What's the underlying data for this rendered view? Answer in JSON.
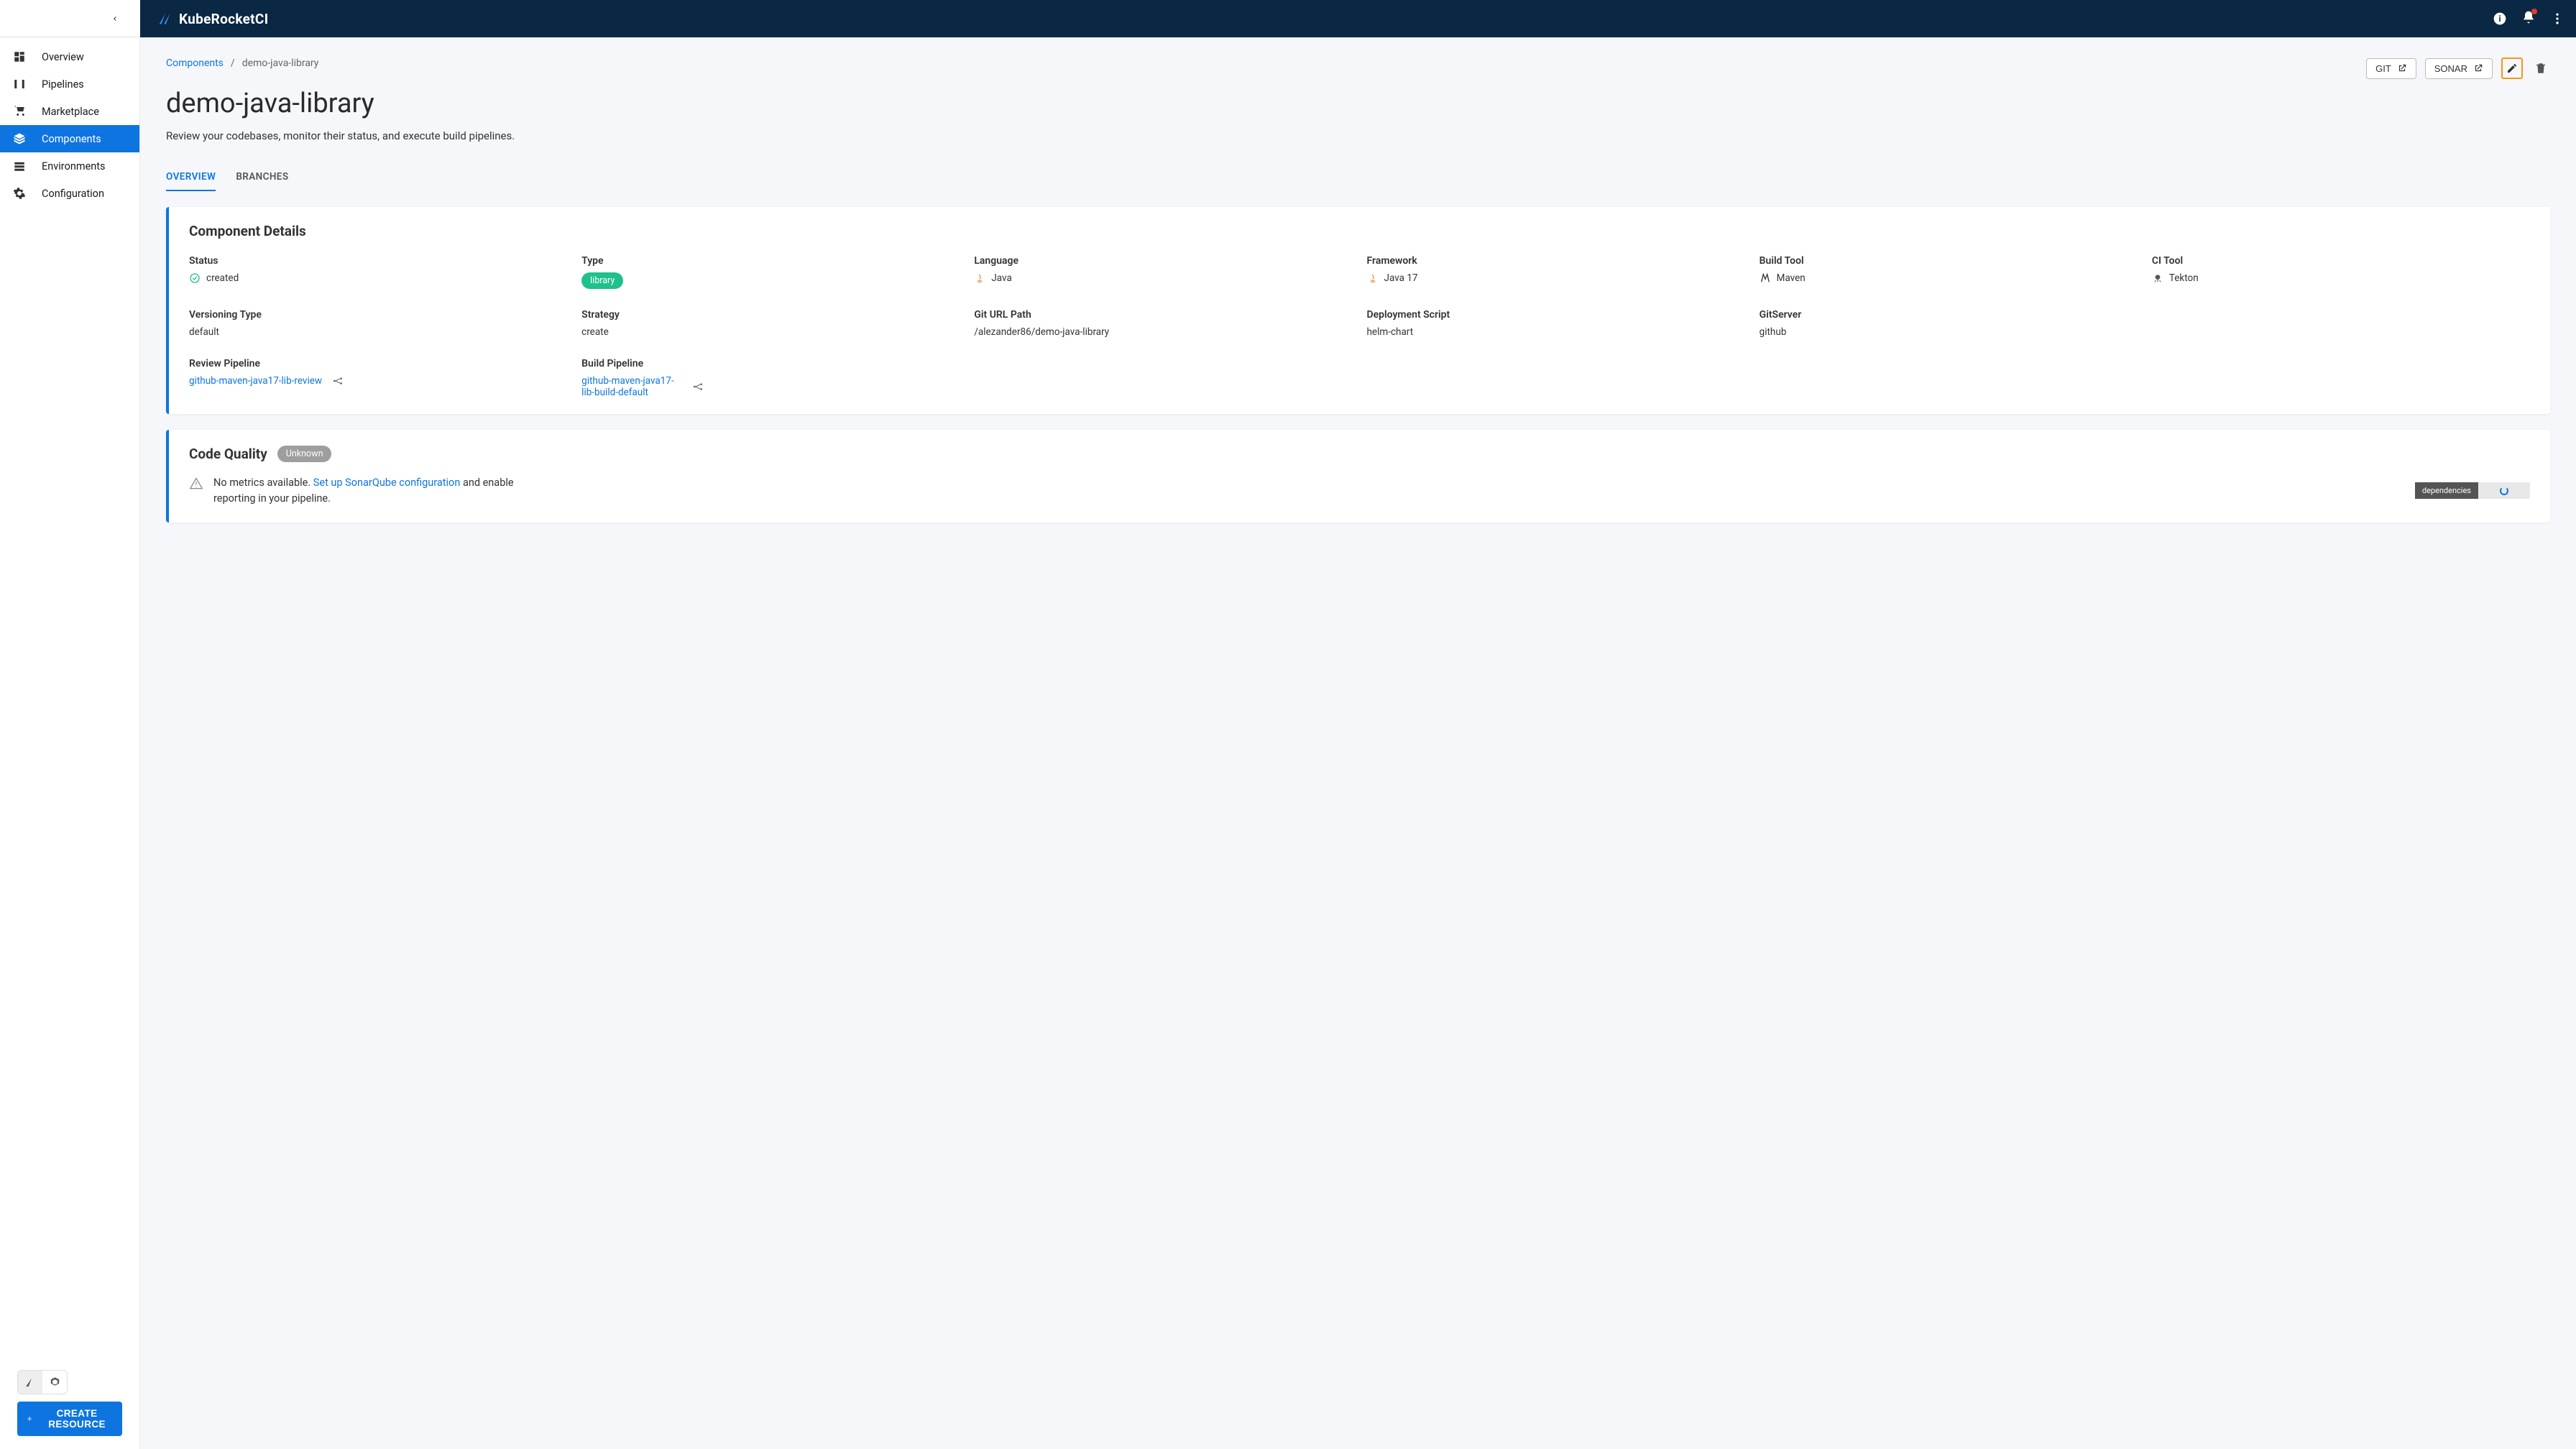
{
  "brand": "KubeRocketCI",
  "sidebar": {
    "items": [
      {
        "label": "Overview"
      },
      {
        "label": "Pipelines"
      },
      {
        "label": "Marketplace"
      },
      {
        "label": "Components"
      },
      {
        "label": "Environments"
      },
      {
        "label": "Configuration"
      }
    ],
    "create_label": "CREATE RESOURCE"
  },
  "breadcrumb": {
    "root": "Components",
    "current": "demo-java-library"
  },
  "actions": {
    "git": "GIT",
    "sonar": "SONAR"
  },
  "page": {
    "title": "demo-java-library",
    "subtitle": "Review your codebases, monitor their status, and execute build pipelines."
  },
  "tabs": {
    "overview": "OVERVIEW",
    "branches": "BRANCHES"
  },
  "component_details": {
    "title": "Component Details",
    "status_label": "Status",
    "status_value": "created",
    "type_label": "Type",
    "type_value": "library",
    "language_label": "Language",
    "language_value": "Java",
    "framework_label": "Framework",
    "framework_value": "Java 17",
    "build_tool_label": "Build Tool",
    "build_tool_value": "Maven",
    "ci_tool_label": "CI Tool",
    "ci_tool_value": "Tekton",
    "versioning_label": "Versioning Type",
    "versioning_value": "default",
    "strategy_label": "Strategy",
    "strategy_value": "create",
    "giturl_label": "Git URL Path",
    "giturl_value": "/alezander86/demo-java-library",
    "deployment_label": "Deployment Script",
    "deployment_value": "helm-chart",
    "gitserver_label": "GitServer",
    "gitserver_value": "github",
    "review_pipeline_label": "Review Pipeline",
    "review_pipeline_value": "github-maven-java17-lib-review",
    "build_pipeline_label": "Build Pipeline",
    "build_pipeline_value": "github-maven-java17-lib-build-default"
  },
  "code_quality": {
    "title": "Code Quality",
    "badge": "Unknown",
    "msg_prefix": "No metrics available. ",
    "msg_link": "Set up SonarQube configuration",
    "msg_suffix": " and enable reporting in your pipeline.",
    "dep_label": "dependencies"
  }
}
